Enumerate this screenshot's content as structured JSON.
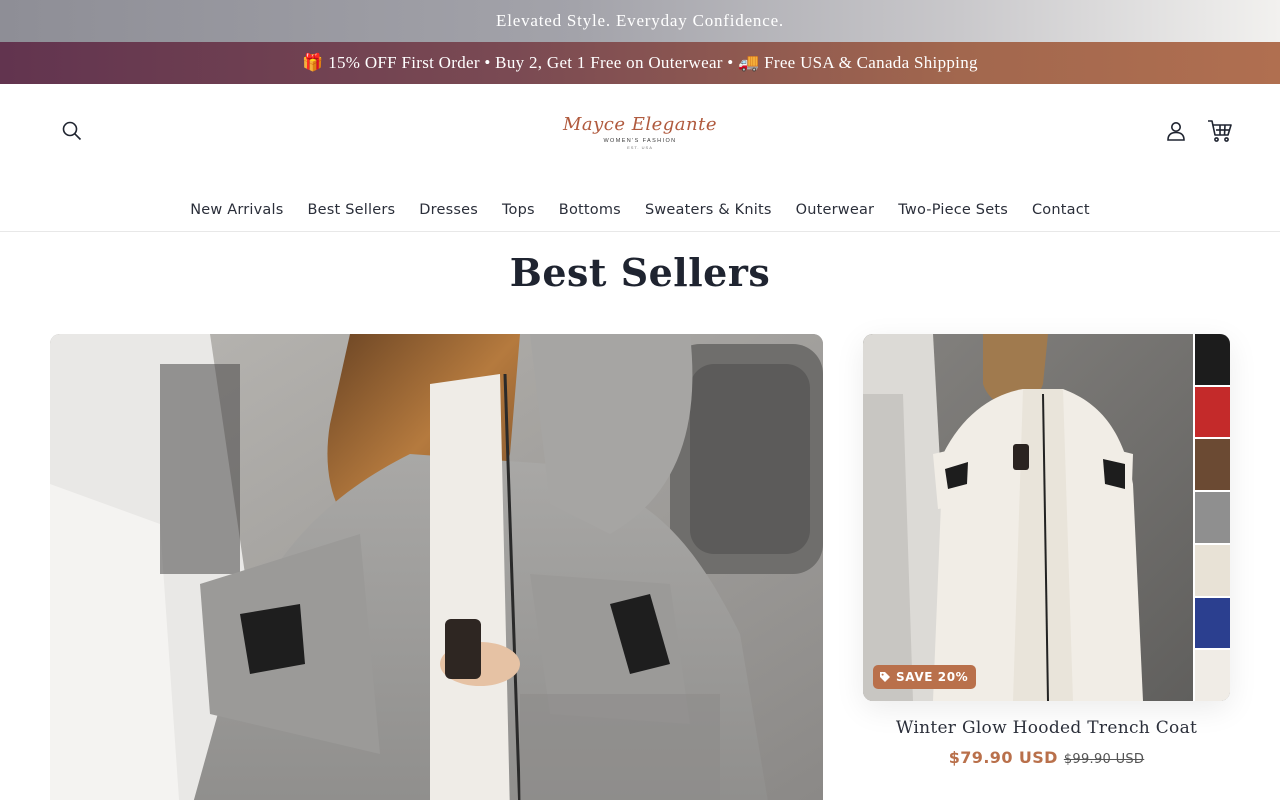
{
  "announcement": {
    "tagline": "Elevated Style. Everyday Confidence.",
    "promo": "🎁 15% OFF First Order • Buy 2, Get 1 Free on Outerwear • 🚚 Free USA & Canada Shipping"
  },
  "header": {
    "logo": {
      "script": "Mayce Elegante",
      "subtitle": "WOMEN'S FASHION",
      "est": "EST. USA"
    },
    "icons": {
      "search": "search-icon",
      "account": "account-icon",
      "cart": "cart-icon"
    }
  },
  "nav": {
    "items": [
      {
        "label": "New Arrivals"
      },
      {
        "label": "Best Sellers"
      },
      {
        "label": "Dresses"
      },
      {
        "label": "Tops"
      },
      {
        "label": "Bottoms"
      },
      {
        "label": "Sweaters & Knits"
      },
      {
        "label": "Outerwear"
      },
      {
        "label": "Two-Piece Sets"
      },
      {
        "label": "Contact"
      }
    ]
  },
  "section": {
    "title": "Best Sellers"
  },
  "product": {
    "badge": "SAVE 20%",
    "title": "Winter Glow Hooded Trench Coat",
    "price": "$79.90 USD",
    "compare_price": "$99.90 USD",
    "color_swatches": [
      "#1c1c1c",
      "#c42a2a",
      "#6b4a33",
      "#8f8f8f",
      "#e8e2d6",
      "#2b3f8f",
      "#f0ece6"
    ]
  },
  "colors": {
    "accent": "#b9704b",
    "promo_start": "#62344f",
    "promo_end": "#b06f50",
    "text": "#1f2430"
  }
}
